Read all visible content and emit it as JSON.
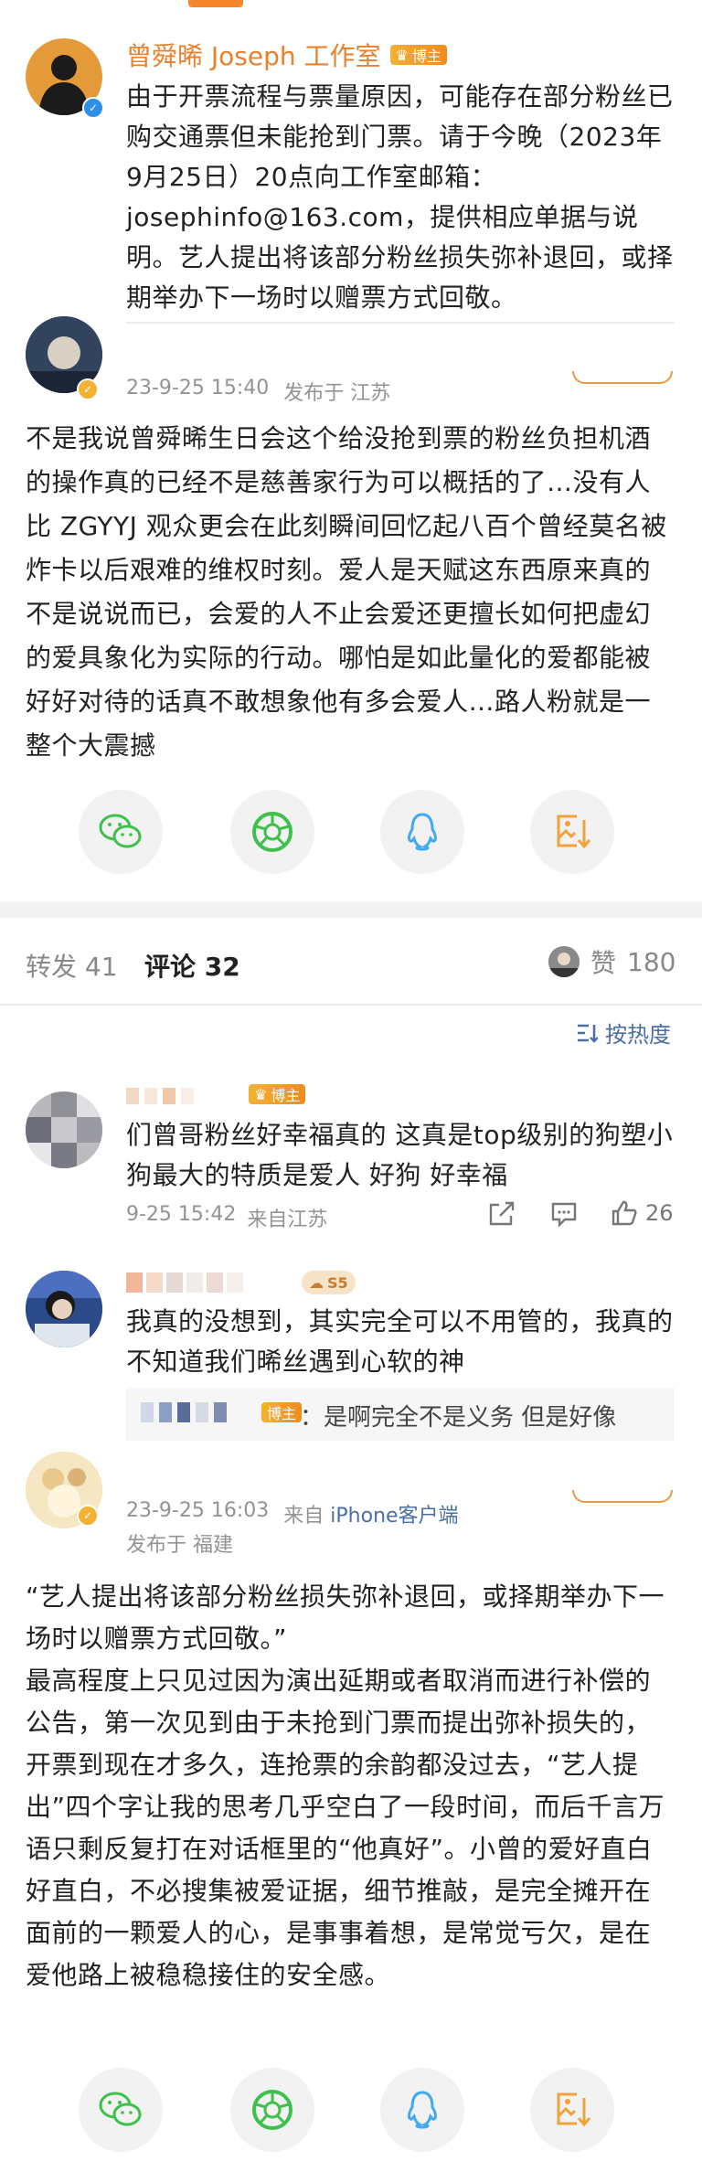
{
  "post": {
    "author": "曾舜晞 Joseph 工作室",
    "author_tag": "博主",
    "text": "由于开票流程与票量原因，可能存在部分粉丝已购交通票但未能抢到门票。请于今晚（2023年9月25日）20点向工作室邮箱：josephinfo@163.com，提供相应单据与说明。艺人提出将该部分粉丝损失弥补退回，或择期举办下一场时以赠票方式回敬。"
  },
  "repost1": {
    "meta_time": "23-9-25 15:40",
    "meta_location": "发布于 江苏",
    "text": "不是我说曾舜晞生日会这个给没抢到票的粉丝负担机酒的操作真的已经不是慈善家行为可以概括的了…没有人比 ZGYYJ 观众更会在此刻瞬间回忆起八百个曾经莫名被炸卡以后艰难的维权时刻。爱人是天赋这东西原来真的不是说说而已，会爱的人不止会爱还更擅长如何把虚幻的爱具象化为实际的行动。哪怕是如此量化的爱都能被好好对待的话真不敢想象他有多会爱人…路人粉就是一整个大震撼"
  },
  "tabs": {
    "repost_label": "转发",
    "repost_count": "41",
    "comment_label": "评论",
    "comment_count": "32",
    "like_label": "赞",
    "like_count": "180"
  },
  "sort": {
    "label": "按热度"
  },
  "comments": [
    {
      "tag": "博主",
      "text": "们曾哥粉丝好幸福真的 这真是top级别的狗塑小狗最大的特质是爱人 好狗 好幸福",
      "time": "9-25 15:42",
      "location": "来自江苏",
      "likes": "26"
    },
    {
      "tag": "S5",
      "text": "我真的没想到，其实完全可以不用管的，我真的不知道我们晞丝遇到心软的神",
      "reply_tag": "博主",
      "reply_text": "：是啊完全不是义务 但是好像"
    }
  ],
  "repost2": {
    "meta_time": "23-9-25 16:03",
    "meta_source_prefix": "来自",
    "meta_source": "iPhone客户端",
    "meta_location": "发布于 福建",
    "text": "“艺人提出将该部分粉丝损失弥补退回，或择期举办下一场时以赠票方式回敬。”\n最高程度上只见过因为演出延期或者取消而进行补偿的公告，第一次见到由于未抢到门票而提出弥补损失的，开票到现在才多久，连抢票的余韵都没过去，“艺人提出”四个字让我的思考几乎空白了一段时间，而后千言万语只剩反复打在对话框里的“他真好”。小曾的爱好直白好直白，不必搜集被爱证据，细节推敲，是完全摊开在面前的一颗爱人的心，是事事着想，是常觉亏欠，是在爱他路上被稳稳接住的安全感。"
  },
  "colors": {
    "link_blue": "#4a6fa5",
    "meta_gray": "#939393",
    "wechat_green": "#3ec04a",
    "moments_green": "#3fbf4c",
    "qq_blue": "#3fa9f5",
    "save_orange": "#f2a23a"
  },
  "icons": [
    "wechat-icon",
    "moments-icon",
    "qq-icon",
    "save-image-icon",
    "verified-icon",
    "sort-icon",
    "share-icon",
    "comment-icon",
    "like-icon"
  ]
}
